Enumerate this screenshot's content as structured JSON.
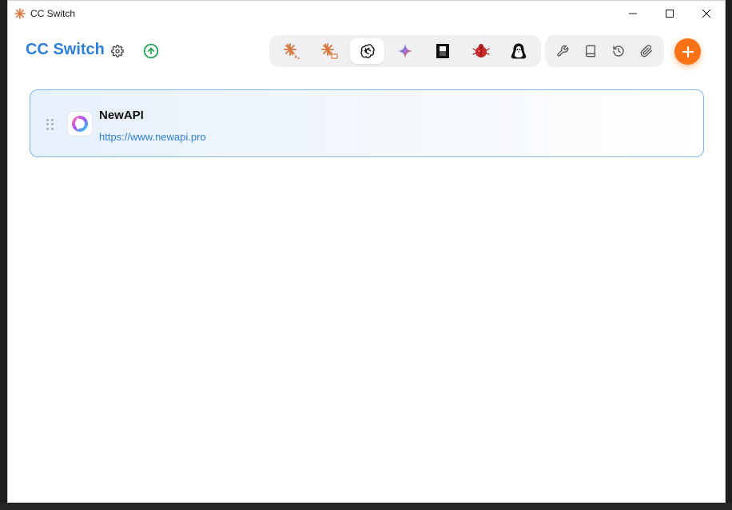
{
  "window": {
    "title": "CC Switch",
    "controls": [
      "minimize",
      "maximize",
      "close"
    ]
  },
  "header": {
    "app_title": "CC Switch",
    "settings_icon": "gear-icon",
    "update_icon": "arrow-up-circle-icon",
    "apps": [
      {
        "name": "claude-code-icon",
        "active": false
      },
      {
        "name": "claude-desktop-icon",
        "active": false
      },
      {
        "name": "openai-codex-icon",
        "active": true
      },
      {
        "name": "gemini-icon",
        "active": false
      },
      {
        "name": "opencode-icon",
        "active": false
      },
      {
        "name": "red-beetle-icon",
        "active": false
      },
      {
        "name": "penguin-icon",
        "active": false
      }
    ],
    "tools": [
      "wrench-icon",
      "book-icon",
      "history-icon",
      "paperclip-icon"
    ],
    "add_button": "plus-icon"
  },
  "providers": [
    {
      "name": "NewAPI",
      "url": "https://www.newapi.pro",
      "selected": true
    }
  ],
  "colors": {
    "accent": "#2e7fd9",
    "add_button": "#f97316",
    "update_icon": "#16a34a",
    "card_border": "#7fb6ee"
  }
}
